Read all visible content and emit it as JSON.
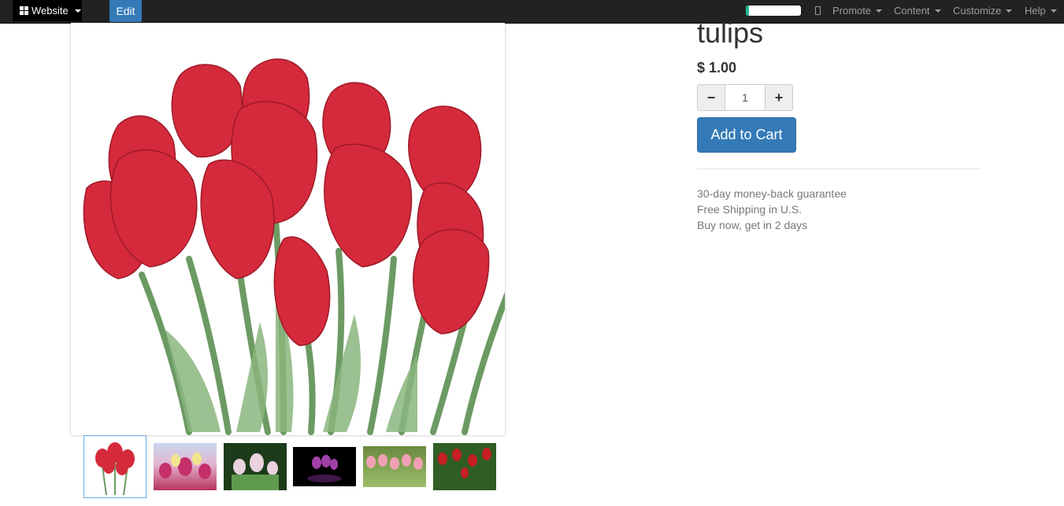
{
  "topbar": {
    "apps_label": "Website",
    "edit_label": "Edit",
    "progress": 0.06,
    "menus": [
      "Promote",
      "Content",
      "Customize",
      "Help"
    ]
  },
  "product": {
    "title": "tulips",
    "price": "$ 1.00",
    "quantity": "1",
    "add_to_cart_label": "Add to Cart"
  },
  "benefits": [
    "30-day money-back guarantee",
    "Free Shipping in U.S.",
    "Buy now, get in 2 days"
  ],
  "icons": {
    "apps": "grid-icon",
    "mobile_preview": "mobile-icon",
    "minus": "minus-icon",
    "plus": "plus-icon"
  },
  "colors": {
    "navbar": "#222222",
    "primary": "#337ab7",
    "progress": "#21b799",
    "tulip_red": "#d42a3c",
    "stem_green": "#7ba572"
  }
}
